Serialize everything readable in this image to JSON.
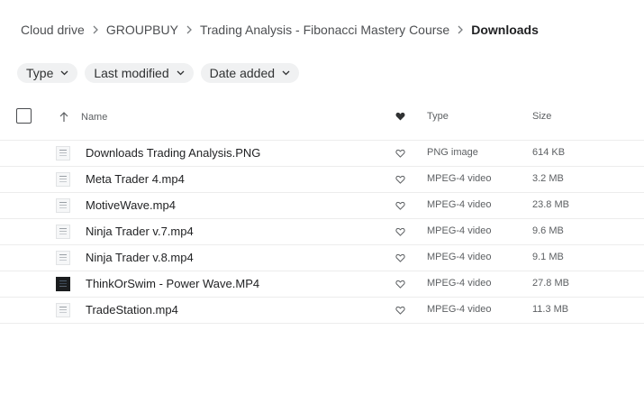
{
  "breadcrumb": {
    "items": [
      "Cloud drive",
      "GROUPBUY",
      "Trading Analysis - Fibonacci Mastery Course",
      "Downloads"
    ]
  },
  "filters": {
    "type_label": "Type",
    "last_modified_label": "Last modified",
    "date_added_label": "Date added"
  },
  "table": {
    "headers": {
      "name": "Name",
      "type": "Type",
      "size": "Size"
    },
    "rows": [
      {
        "name": "Downloads Trading Analysis.PNG",
        "type": "PNG image",
        "size": "614 KB",
        "thumb": "image-thumb-icon"
      },
      {
        "name": "Meta Trader 4.mp4",
        "type": "MPEG-4 video",
        "size": "3.2 MB",
        "thumb": "video-thumb-icon"
      },
      {
        "name": "MotiveWave.mp4",
        "type": "MPEG-4 video",
        "size": "23.8 MB",
        "thumb": "video-thumb-icon"
      },
      {
        "name": "Ninja Trader v.7.mp4",
        "type": "MPEG-4 video",
        "size": "9.6 MB",
        "thumb": "video-thumb-icon"
      },
      {
        "name": "Ninja Trader v.8.mp4",
        "type": "MPEG-4 video",
        "size": "9.1 MB",
        "thumb": "video-thumb-icon"
      },
      {
        "name": "ThinkOrSwim - Power Wave.MP4",
        "type": "MPEG-4 video",
        "size": "27.8 MB",
        "thumb": "video-thumb-dark-icon"
      },
      {
        "name": "TradeStation.mp4",
        "type": "MPEG-4 video",
        "size": "11.3 MB",
        "thumb": "video-thumb-icon"
      }
    ]
  },
  "colors": {
    "text_primary": "#1f2022",
    "text_secondary": "#5d6063",
    "chip_background": "#f0f1f2",
    "divider": "#ececec"
  }
}
